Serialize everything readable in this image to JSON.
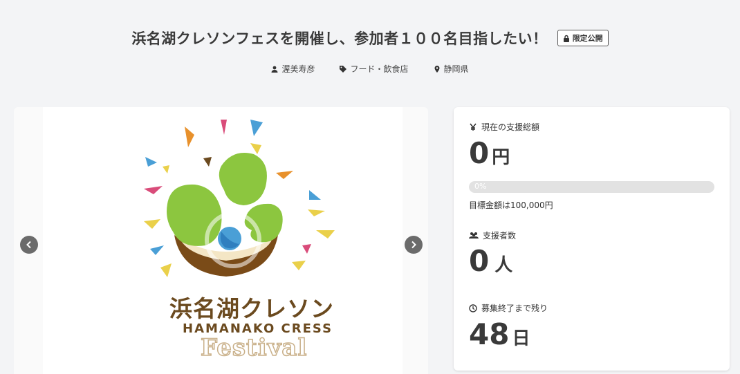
{
  "header": {
    "title": "浜名湖クレソンフェスを開催し、参加者１００名目指したい！",
    "badge": "限定公開",
    "owner": "渥美寿彦",
    "category": "フード・飲食店",
    "location": "静岡県"
  },
  "gallery": {
    "logo_text_jp": "浜名湖クレソン",
    "logo_text_en": "HAMANAKO CRESS",
    "logo_text_fest": "Festival"
  },
  "stats": {
    "total_label": "現在の支援総額",
    "total_value": "0",
    "total_unit": "円",
    "progress_percent_text": "0%",
    "progress_fraction": 0,
    "goal_text": "目標金額は100,000円",
    "supporters_label": "支援者数",
    "supporters_value": "0",
    "supporters_unit": "人",
    "remaining_label": "募集終了まで残り",
    "remaining_value": "48",
    "remaining_unit": "日"
  },
  "icons": {
    "lock": "lock-icon",
    "user": "user-icon",
    "tag": "tag-icon",
    "pin": "map-pin-icon",
    "yen": "yen-icon",
    "people": "users-icon",
    "clock": "clock-icon",
    "prev": "chevron-left-icon",
    "next": "chevron-right-icon"
  },
  "colors": {
    "background": "#f3f4f6",
    "accent_green": "#8cc63f",
    "brown": "#6b4a1f",
    "nav_button": "#6b6b6b"
  }
}
